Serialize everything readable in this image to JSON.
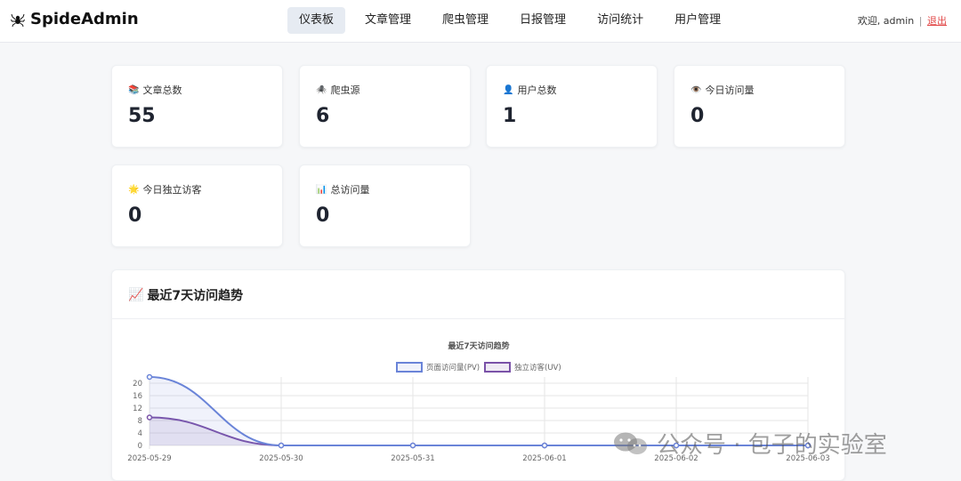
{
  "brand": {
    "name": "SpideAdmin",
    "icon": "spider-icon"
  },
  "nav": [
    {
      "label": "仪表板",
      "active": true
    },
    {
      "label": "文章管理",
      "active": false
    },
    {
      "label": "爬虫管理",
      "active": false
    },
    {
      "label": "日报管理",
      "active": false
    },
    {
      "label": "访问统计",
      "active": false
    },
    {
      "label": "用户管理",
      "active": false
    }
  ],
  "user": {
    "welcome": "欢迎, admin",
    "separator": "|",
    "logout": "退出"
  },
  "stats": [
    {
      "icon": "📚",
      "label": "文章总数",
      "value": "55"
    },
    {
      "icon": "🕷️",
      "label": "爬虫源",
      "value": "6"
    },
    {
      "icon": "👤",
      "label": "用户总数",
      "value": "1"
    },
    {
      "icon": "👁️",
      "label": "今日访问量",
      "value": "0"
    },
    {
      "icon": "🌟",
      "label": "今日独立访客",
      "value": "0"
    },
    {
      "icon": "📊",
      "label": "总访问量",
      "value": "0"
    }
  ],
  "trend": {
    "heading_icon": "📈",
    "heading": "最近7天访问趋势"
  },
  "chart_data": {
    "type": "line",
    "title": "最近7天访问趋势",
    "x": [
      "2025-05-29",
      "2025-05-30",
      "2025-05-31",
      "2025-06-01",
      "2025-06-02",
      "2025-06-03"
    ],
    "y_ticks": [
      0,
      4,
      8,
      12,
      16,
      20
    ],
    "ylim": [
      0,
      22
    ],
    "grid": true,
    "legend": "top",
    "series": [
      {
        "name": "页面访问量(PV)",
        "values": [
          22,
          0,
          0,
          0,
          0,
          0
        ],
        "color": "#6a84d8",
        "fill": "rgba(106,132,216,0.10)"
      },
      {
        "name": "独立访客(UV)",
        "values": [
          9,
          0,
          0,
          0,
          0,
          0
        ],
        "color": "#7a52a8",
        "fill": "rgba(122,82,168,0.12)"
      }
    ]
  },
  "watermark": {
    "text": "公众号 · 包子的实验室",
    "icon": "wechat-icon"
  }
}
